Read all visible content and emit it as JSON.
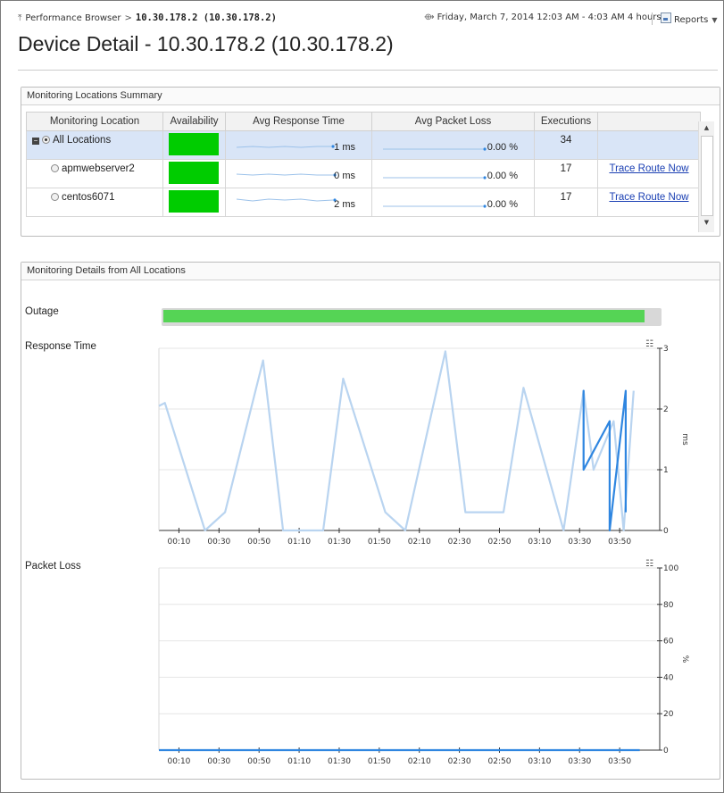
{
  "breadcrumb": {
    "parent": "Performance Browser",
    "separator": ">",
    "current": "10.30.178.2 (10.30.178.2)"
  },
  "time_range": {
    "label": "Friday, March 7, 2014 12:03 AM - 4:03 AM 4 hours"
  },
  "reports": {
    "label": "Reports"
  },
  "page_title": "Device Detail - 10.30.178.2 (10.30.178.2)",
  "summary": {
    "title": "Monitoring Locations Summary",
    "columns": [
      "Monitoring Location",
      "Availability",
      "Avg Response Time",
      "Avg Packet Loss",
      "Executions",
      ""
    ],
    "rows": [
      {
        "location": "All Locations",
        "availability_color": "#00cc00",
        "avg_response": "1 ms",
        "avg_packet_loss": "0.00 %",
        "executions": "34",
        "action": ""
      },
      {
        "location": "apmwebserver2",
        "availability_color": "#00cc00",
        "avg_response": "0 ms",
        "avg_packet_loss": "0.00 %",
        "executions": "17",
        "action": "Trace Route Now"
      },
      {
        "location": "centos6071",
        "availability_color": "#00cc00",
        "avg_response": "2 ms",
        "avg_packet_loss": "0.00 %",
        "executions": "17",
        "action": "Trace Route Now"
      }
    ]
  },
  "details": {
    "title": "Monitoring Details from All Locations",
    "outage": {
      "label": "Outage",
      "availability_fraction": 0.97,
      "color": "#55d455"
    }
  },
  "chart_data": [
    {
      "type": "line",
      "title": "Response Time",
      "ylabel": "ms",
      "ylim": [
        0,
        3
      ],
      "yticks": [
        "0",
        "1",
        "2",
        "3"
      ],
      "xlim": [
        0,
        250
      ],
      "xtick_positions": [
        10,
        30,
        50,
        70,
        90,
        110,
        130,
        150,
        170,
        190,
        210,
        230
      ],
      "xtick_labels": [
        "00:10",
        "00:30",
        "00:50",
        "01:10",
        "01:30",
        "01:50",
        "02:10",
        "02:30",
        "02:50",
        "03:10",
        "03:30",
        "03:50"
      ],
      "grid": true,
      "series": [
        {
          "color": "#b9d4f0",
          "x": [
            0,
            3,
            23,
            33,
            52,
            62,
            82,
            92,
            113,
            123,
            143,
            153,
            172,
            182,
            202,
            212,
            217,
            227,
            232,
            237
          ],
          "y": [
            2.05,
            2.1,
            0,
            0.3,
            2.8,
            0,
            0,
            2.5,
            0.3,
            0,
            2.95,
            0.3,
            0.3,
            2.35,
            0,
            2.3,
            1.0,
            1.8,
            0,
            2.3
          ]
        },
        {
          "color": "#2f86e0",
          "x": [
            212,
            212,
            212,
            225,
            225,
            233,
            233
          ],
          "y": [
            1.0,
            2.3,
            1.0,
            1.8,
            0,
            2.3,
            0.3
          ]
        }
      ]
    },
    {
      "type": "line",
      "title": "Packet Loss",
      "ylabel": "%",
      "ylim": [
        0,
        100
      ],
      "yticks": [
        "0",
        "20",
        "40",
        "60",
        "80",
        "100"
      ],
      "xlim": [
        0,
        250
      ],
      "xtick_positions": [
        10,
        30,
        50,
        70,
        90,
        110,
        130,
        150,
        170,
        190,
        210,
        230
      ],
      "xtick_labels": [
        "00:10",
        "00:30",
        "00:50",
        "01:10",
        "01:30",
        "01:50",
        "02:10",
        "02:30",
        "02:50",
        "03:10",
        "03:30",
        "03:50"
      ],
      "grid": true,
      "series": [
        {
          "color": "#2f86e0",
          "x": [
            0,
            240
          ],
          "y": [
            0,
            0
          ]
        }
      ]
    }
  ]
}
